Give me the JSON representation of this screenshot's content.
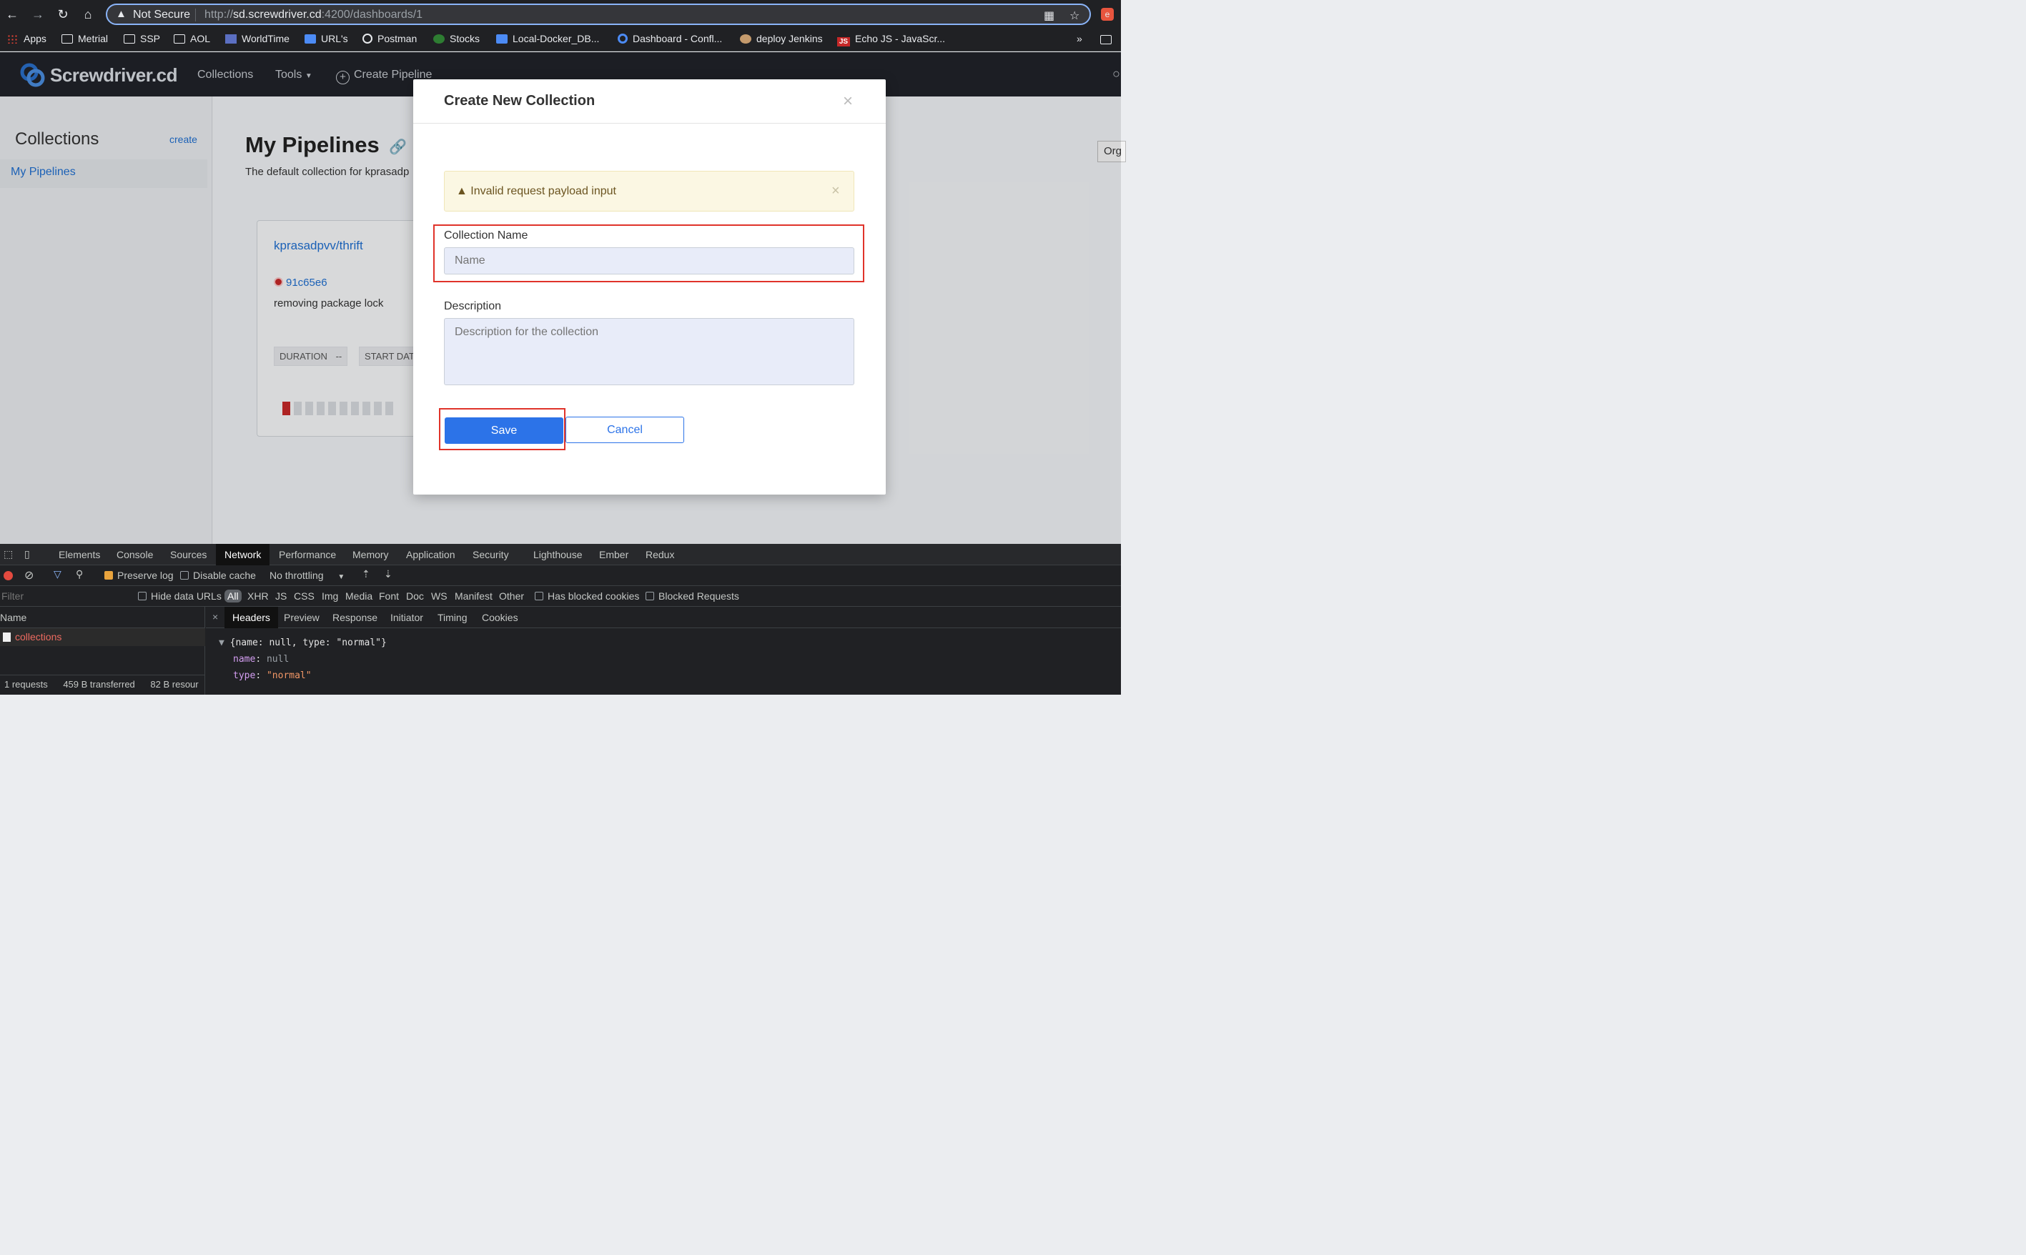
{
  "browser": {
    "security_label": "Not Secure",
    "url_host": "sd.screwdriver.cd",
    "url_prefix": "http://",
    "url_suffix": ":4200/dashboards/1",
    "bookmarks": [
      {
        "label": "Apps",
        "icon": "apps-grid-icon"
      },
      {
        "label": "Metrial",
        "icon": "folder-icon"
      },
      {
        "label": "SSP",
        "icon": "folder-icon"
      },
      {
        "label": "AOL",
        "icon": "folder-icon"
      },
      {
        "label": "WorldTime",
        "icon": "worldtime-icon"
      },
      {
        "label": "URL's",
        "icon": "doc-icon"
      },
      {
        "label": "Postman",
        "icon": "postman-icon"
      },
      {
        "label": "Stocks",
        "icon": "stocks-icon"
      },
      {
        "label": "Local-Docker_DB...",
        "icon": "doc-icon"
      },
      {
        "label": "Dashboard - Confl...",
        "icon": "confluence-icon"
      },
      {
        "label": "deploy Jenkins",
        "icon": "jenkins-icon"
      },
      {
        "label": "Echo JS - JavaScr...",
        "icon": "js-icon"
      }
    ],
    "bookmarks_more": "»"
  },
  "app_nav": {
    "brand": "Screwdriver.cd",
    "collections": "Collections",
    "tools": "Tools",
    "create_pipeline": "Create Pipeline"
  },
  "sidebar": {
    "title": "Collections",
    "create": "create",
    "items": [
      {
        "label": "My Pipelines"
      }
    ]
  },
  "main": {
    "title": "My Pipelines",
    "description": "The default collection for kprasadp",
    "org_button": "Org"
  },
  "pipeline_card": {
    "name": "kprasadpvv/thrift",
    "sha": "91c65e6",
    "message": "removing package lock",
    "duration_label": "DURATION",
    "duration_value": "--",
    "start_label": "START DAT",
    "history": [
      "failed",
      "none",
      "none",
      "none",
      "none",
      "none",
      "none",
      "none",
      "none",
      "none"
    ]
  },
  "modal": {
    "title": "Create New Collection",
    "close": "×",
    "alert": {
      "text": "Invalid request payload input",
      "close": "×"
    },
    "name_label": "Collection Name",
    "name_placeholder": "Name",
    "description_label": "Description",
    "description_placeholder": "Description for the collection",
    "save": "Save",
    "cancel": "Cancel"
  },
  "devtools": {
    "tabs": [
      "Elements",
      "Console",
      "Sources",
      "Network",
      "Performance",
      "Memory",
      "Application",
      "Security",
      "Lighthouse",
      "Ember",
      "Redux"
    ],
    "active_tab": "Network",
    "toolbar": {
      "preserve_log": "Preserve log",
      "disable_cache": "Disable cache",
      "throttling": "No throttling"
    },
    "filter_placeholder": "Filter",
    "filter_bar": {
      "hide_data_urls": "Hide data URLs",
      "all": "All",
      "types": [
        "XHR",
        "JS",
        "CSS",
        "Img",
        "Media",
        "Font",
        "Doc",
        "WS",
        "Manifest",
        "Other"
      ],
      "blocked_cookies": "Has blocked cookies",
      "blocked_requests": "Blocked Requests"
    },
    "name_header": "Name",
    "request": "collections",
    "status": {
      "requests": "1 requests",
      "transferred": "459 B transferred",
      "resources": "82 B resour"
    },
    "detail_tabs": [
      "Headers",
      "Preview",
      "Response",
      "Initiator",
      "Timing",
      "Cookies"
    ],
    "active_detail_tab": "Headers",
    "close_icon": "×",
    "payload": {
      "summary": "{name: null, type: \"normal\"}",
      "name_key": "name",
      "name_value": "null",
      "type_key": "type",
      "type_value": "\"normal\""
    }
  },
  "colors": {
    "primary": "#2c73e8",
    "highlight": "#e0332a",
    "alert_bg": "#fbf7e3",
    "nav_bg": "#20232a"
  }
}
